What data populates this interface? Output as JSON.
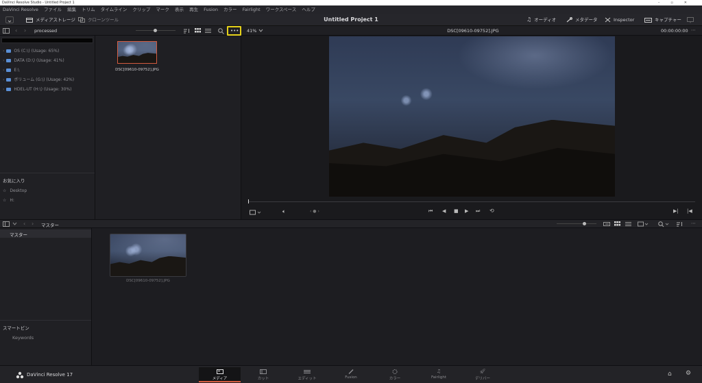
{
  "window": {
    "title": "DaVinci Resolve Studio - Untitled Project 1"
  },
  "menu": [
    "DaVinci Resolve",
    "ファイル",
    "編集",
    "トリム",
    "タイムライン",
    "クリップ",
    "マーク",
    "表示",
    "再生",
    "Fusion",
    "カラー",
    "Fairlight",
    "ワークスペース",
    "ヘルプ"
  ],
  "toolbar": {
    "media_storage": "メディアストレージ",
    "clone_tool": "クローンツール",
    "project_title": "Untitled Project 1",
    "audio": "オーディオ",
    "metadata": "メタデータ",
    "inspector": "Inspector",
    "capture": "キャプチャー"
  },
  "media_pool_top": {
    "folder": "processed",
    "zoom": "41%",
    "clip_name": "DSC[09610-09752].JPG",
    "timecode": "00:00:00:00"
  },
  "drives": [
    "OS (C:\\) (Usage: 65%)",
    "DATA (D:\\) (Usage: 41%)",
    "E:\\",
    "ボリューム (G:\\) (Usage: 42%)",
    "HDEL-UT (H:\\) (Usage: 30%)"
  ],
  "favorites": {
    "title": "お気に入り",
    "items": [
      "Desktop",
      "H:"
    ]
  },
  "bin_clip": {
    "name": "DSC[09610-09752].JPG"
  },
  "pool": {
    "bin": "マスター",
    "tree_item": "マスター",
    "clip_name": "DSC[09610-09752].JPG"
  },
  "smart_bins": {
    "title": "スマートビン",
    "items": [
      "Keywords"
    ]
  },
  "app": {
    "name": "DaVinci Resolve 17"
  },
  "pages": [
    "メディア",
    "カット",
    "エディット",
    "Fusion",
    "カラー",
    "Fairlight",
    "デリバー"
  ],
  "colors": {
    "accent": "#d45b3f",
    "highlight": "#e6d21a",
    "drive": "#5a8fd6"
  }
}
